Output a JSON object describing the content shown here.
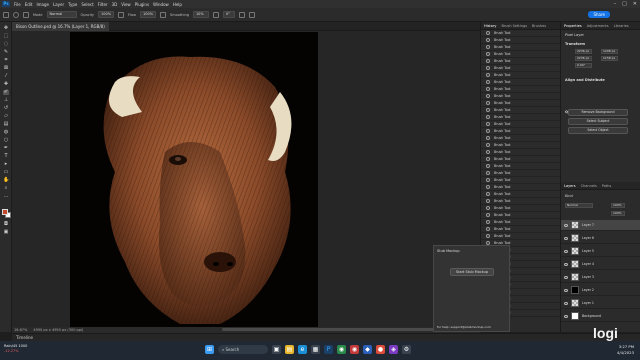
{
  "menubar": {
    "logo": "Ps",
    "items": [
      "File",
      "Edit",
      "Image",
      "Layer",
      "Type",
      "Select",
      "Filter",
      "3D",
      "View",
      "Plugins",
      "Window",
      "Help"
    ]
  },
  "options": {
    "mode_label": "Mode",
    "mode_value": "Normal",
    "opacity_label": "Opacity",
    "opacity_value": "100%",
    "flow_label": "Flow",
    "flow_value": "100%",
    "smoothing_label": "Smoothing",
    "smoothing_value": "10%",
    "angle_value": "0°",
    "share_label": "Share"
  },
  "document": {
    "tab_title": "Bison Outline.psd @ 16.7% (Layer 1, RGB/8)",
    "status_zoom": "16.67%",
    "status_size": "4950 px x 4950 px (300 ppi)"
  },
  "history": {
    "tabs": [
      "History",
      "Brush Settings",
      "Brushes"
    ],
    "item_label": "Brush Tool",
    "count": 41
  },
  "properties": {
    "tabs": [
      "Properties",
      "Adjustments",
      "Libraries"
    ],
    "layer_type": "Pixel Layer",
    "transform_title": "Transform",
    "w": "2236 px",
    "h": "2236 px",
    "x": "1208 px",
    "y": "1158 px",
    "angle": "0.00°",
    "align_title": "Align and Distribute",
    "quick_actions_title": "Quick Actions",
    "quick_actions": [
      "Remove Background",
      "Select Subject",
      "Select Object"
    ]
  },
  "layers": {
    "tabs": [
      "Layers",
      "Channels",
      "Paths"
    ],
    "kind_label": "Kind",
    "blend": "Normal",
    "opacity": "100%",
    "fill": "100%",
    "items": [
      {
        "name": "Layer 7",
        "thumb": "checker",
        "selected": true
      },
      {
        "name": "Layer 6",
        "thumb": "checker",
        "selected": false
      },
      {
        "name": "Layer 5",
        "thumb": "checker",
        "selected": false
      },
      {
        "name": "Layer 4",
        "thumb": "checker",
        "selected": false
      },
      {
        "name": "Layer 3",
        "thumb": "checker",
        "selected": false
      },
      {
        "name": "Layer 2",
        "thumb": "black",
        "selected": false
      },
      {
        "name": "Layer 1",
        "thumb": "checker",
        "selected": false
      },
      {
        "name": "Background",
        "thumb": "white",
        "selected": false
      }
    ]
  },
  "stub_panel": {
    "title": "Stub Mockup",
    "button": "Start Stub Mockup",
    "footer": "for help: support@stubmockup.com"
  },
  "timeline": {
    "label": "Timeline"
  },
  "taskbar": {
    "weather_temp": "Rain/45 1000",
    "weather_change": "-12.27%",
    "search_placeholder": "Search",
    "time": "3:27 PM",
    "date": "4/4/2023"
  },
  "watermark": "logi",
  "colors": {
    "accent": "#31a8ff",
    "share": "#1473e6",
    "foreground_swatch": "#c04a2b",
    "background_swatch": "#ffffff"
  }
}
